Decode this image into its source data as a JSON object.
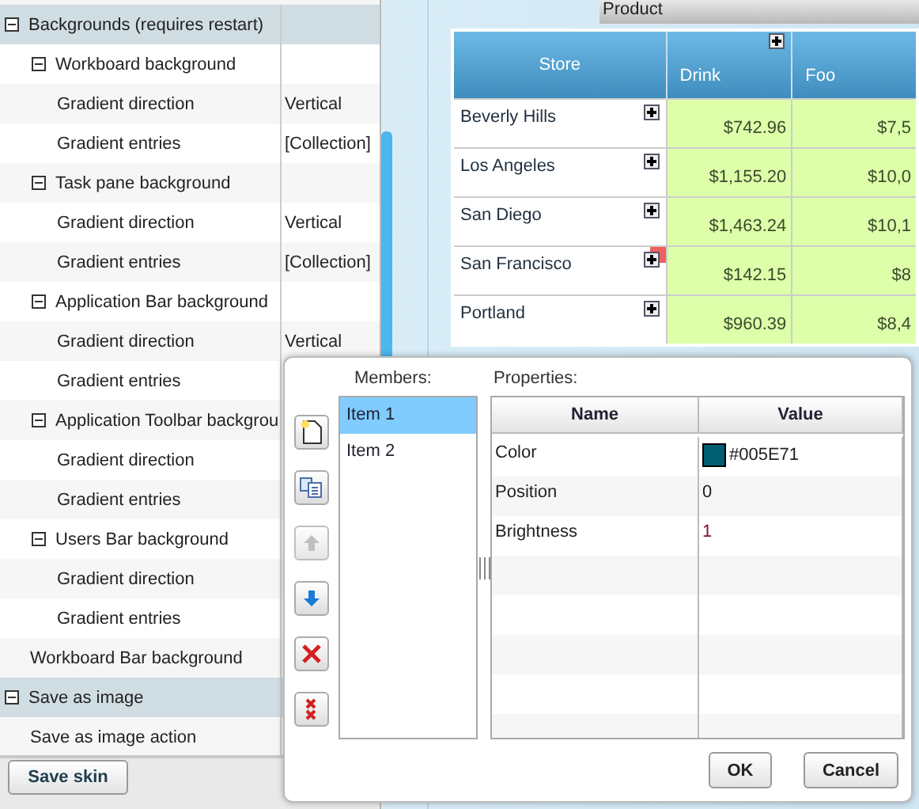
{
  "property_grid": {
    "sections": [
      {
        "label": "Backgrounds (requires restart)",
        "expanded": true,
        "children": [
          {
            "label": "Workboard background",
            "expanded": true,
            "children": [
              {
                "label": "Gradient direction",
                "value": "Vertical"
              },
              {
                "label": "Gradient entries",
                "value": "[Collection]"
              }
            ]
          },
          {
            "label": "Task pane background",
            "expanded": true,
            "children": [
              {
                "label": "Gradient direction",
                "value": "Vertical"
              },
              {
                "label": "Gradient entries",
                "value": "[Collection]"
              }
            ]
          },
          {
            "label": "Application Bar background",
            "expanded": true,
            "children": [
              {
                "label": "Gradient direction",
                "value": "Vertical"
              },
              {
                "label": "Gradient entries"
              }
            ]
          },
          {
            "label": "Application Toolbar backgrou",
            "expanded": true,
            "children": [
              {
                "label": "Gradient direction"
              },
              {
                "label": "Gradient entries"
              }
            ]
          },
          {
            "label": "Users Bar background",
            "expanded": true,
            "children": [
              {
                "label": "Gradient direction"
              },
              {
                "label": "Gradient entries"
              }
            ]
          },
          {
            "label": "Workboard Bar background"
          }
        ]
      },
      {
        "label": "Save as image",
        "expanded": true,
        "children": [
          {
            "label": "Save as image action"
          }
        ]
      }
    ]
  },
  "save_button": "Save skin",
  "pivot": {
    "column_header": "Product",
    "row_header": "Store",
    "columns": [
      "Drink",
      "Foo"
    ],
    "rows": [
      {
        "store": "Beverly Hills",
        "flagged": false,
        "values": [
          "$742.96",
          "$7,5"
        ]
      },
      {
        "store": "Los Angeles",
        "flagged": false,
        "values": [
          "$1,155.20",
          "$10,0"
        ]
      },
      {
        "store": "San Diego",
        "flagged": false,
        "values": [
          "$1,463.24",
          "$10,1"
        ]
      },
      {
        "store": "San Francisco",
        "flagged": true,
        "values": [
          "$142.15",
          "$8"
        ]
      },
      {
        "store": "Portland",
        "flagged": false,
        "values": [
          "$960.39",
          "$8,4"
        ]
      }
    ]
  },
  "dialog": {
    "members_label": "Members:",
    "properties_label": "Properties:",
    "tools": [
      {
        "kind": "new",
        "disabled": false
      },
      {
        "kind": "copy",
        "disabled": false
      },
      {
        "kind": "up",
        "disabled": true
      },
      {
        "kind": "down",
        "disabled": false
      },
      {
        "kind": "delete",
        "disabled": false
      },
      {
        "kind": "delete_all",
        "disabled": false
      }
    ],
    "members": [
      {
        "label": "Item 1",
        "selected": true
      },
      {
        "label": "Item 2",
        "selected": false
      }
    ],
    "columns": [
      "Name",
      "Value"
    ],
    "properties": [
      {
        "kind": "color",
        "name": "Color",
        "value": "#005E71",
        "color": "#005e71"
      },
      {
        "kind": "text",
        "name": "Position",
        "value": "0"
      },
      {
        "kind": "number",
        "name": "Brightness",
        "value": "1"
      }
    ],
    "buttons": [
      "OK",
      "Cancel"
    ]
  }
}
